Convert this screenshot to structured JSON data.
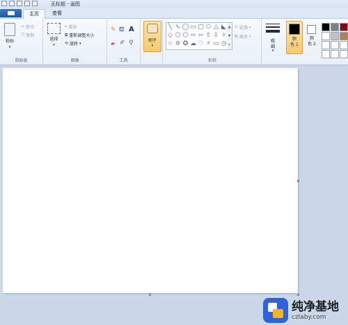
{
  "window": {
    "title": "无标题 - 画图"
  },
  "tabs": {
    "home": "主页",
    "view": "查看"
  },
  "clipboard": {
    "paste": "粘贴",
    "cut": "剪切",
    "copy": "复制",
    "group_label": "剪贴板"
  },
  "image": {
    "select": "选择",
    "crop": "裁剪",
    "resize": "重新调整大小",
    "rotate": "旋转",
    "group_label": "图像"
  },
  "tools": {
    "group_label": "工具",
    "text_glyph": "A"
  },
  "brushes": {
    "label": "刷子"
  },
  "shapes": {
    "outline": "轮廓",
    "fill": "填充",
    "group_label": "形状",
    "glyphs": [
      "╲",
      "∿",
      "◯",
      "▭",
      "▢",
      "⬭",
      "△",
      "◣",
      "◇",
      "⬠",
      "⬡",
      "⇨",
      "⇦",
      "⇧",
      "⇩",
      "✧",
      "☆",
      "✡",
      "✪",
      "☁",
      "♡",
      "⚡",
      "▭",
      "◷"
    ]
  },
  "size": {
    "label_line1": "粗",
    "label_line2": "细"
  },
  "colors": {
    "color1_line1": "颜",
    "color1_line2": "色 1",
    "color2_line1": "颜",
    "color2_line2": "色 2",
    "color1_value": "#000000",
    "color2_value": "#ffffff",
    "palette": [
      "#000000",
      "#7f7f7f",
      "#880015",
      "#ffffff",
      "#c3c3c3",
      "#b97a57",
      "#ffffff",
      "#ffffff",
      "#ffffff",
      "#ffffff",
      "#ffffff",
      "#ffffff"
    ]
  },
  "watermark": {
    "name": "纯净基地",
    "url": "czlaby.com"
  }
}
